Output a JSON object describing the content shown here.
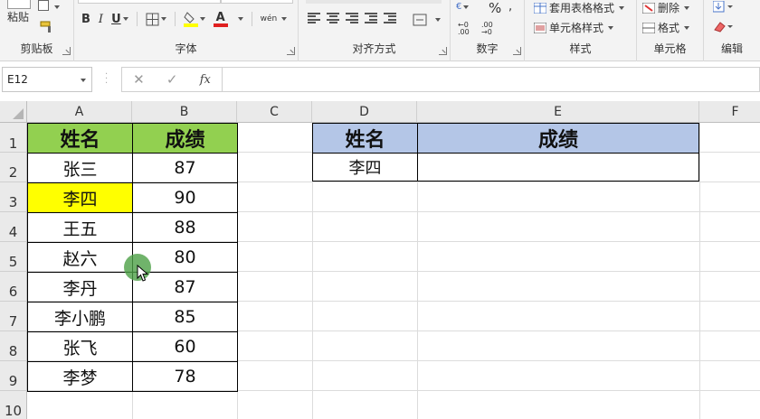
{
  "ribbon": {
    "clipboard": {
      "label": "剪贴板",
      "paste_label": "粘贴"
    },
    "font": {
      "label": "字体",
      "bold": "B",
      "italic": "I",
      "underline": "U",
      "font_color_glyph": "A",
      "phonetic_glyph": "wén"
    },
    "alignment": {
      "label": "对齐方式"
    },
    "number": {
      "label": "数字",
      "percent": "%"
    },
    "styles": {
      "label": "样式",
      "table_format": "套用表格格式",
      "cell_styles": "单元格样式"
    },
    "cells": {
      "label": "单元格",
      "delete": "删除",
      "format": "格式"
    },
    "editing": {
      "label": "编辑"
    }
  },
  "formula_bar": {
    "name_box": "E12",
    "value": ""
  },
  "sheet": {
    "columns": [
      "A",
      "B",
      "C",
      "D",
      "E",
      "F"
    ],
    "rows": [
      "1",
      "2",
      "3",
      "4",
      "5",
      "6",
      "7",
      "8",
      "9",
      "10"
    ],
    "table1": {
      "header": [
        "姓名",
        "成绩"
      ],
      "rows": [
        [
          "张三",
          "87"
        ],
        [
          "李四",
          "90"
        ],
        [
          "王五",
          "88"
        ],
        [
          "赵六",
          "80"
        ],
        [
          "李丹",
          "87"
        ],
        [
          "李小鹏",
          "85"
        ],
        [
          "张飞",
          "60"
        ],
        [
          "李梦",
          "78"
        ]
      ]
    },
    "table2": {
      "header": [
        "姓名",
        "成绩"
      ],
      "row": [
        "李四",
        ""
      ]
    }
  },
  "colors": {
    "header_green": "#92d050",
    "header_blue": "#b4c6e7",
    "highlight_yellow": "#ffff00"
  }
}
